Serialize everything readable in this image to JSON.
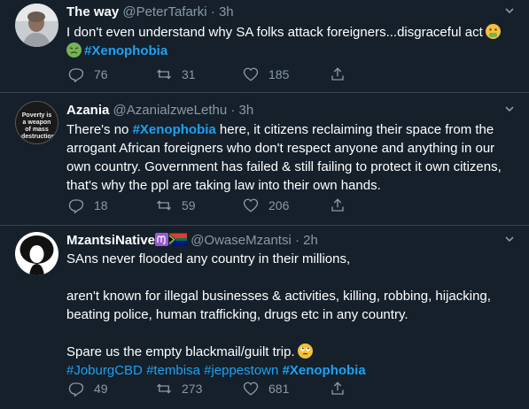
{
  "tweets": [
    {
      "name": "The way",
      "handle": "@PeterTafarki",
      "dot": "·",
      "time": "3h",
      "lines": [
        "I don't even understand why SA folks attack foreigners...disgraceful act"
      ],
      "hashtag_line": "#Xenophobia",
      "stats": {
        "replies": "76",
        "retweets": "31",
        "likes": "185"
      }
    },
    {
      "name": "Azania",
      "handle": "@AzanialzweLethu",
      "dot": "·",
      "time": "3h",
      "avatar_text": "Poverty is a weapon of mass destruction",
      "text_before": "There's no ",
      "hashtag": "#Xenophobia",
      "text_after": " here, it citizens reclaiming their space from the arrogant African foreigners who don't respect anyone and anything in our own country. Government has failed & still failing to protect it own citizens, that's why the ppl are taking law into their own hands.",
      "stats": {
        "replies": "18",
        "retweets": "59",
        "likes": "206"
      }
    },
    {
      "name": "MzantsiNative",
      "handle": "@OwaseMzantsi",
      "dot": "·",
      "time": "2h",
      "para1": "SAns never flooded any country in their millions,",
      "para2": "aren't known for illegal businesses & activities, killing, robbing, hijacking, beating police, human trafficking, drugs etc in any country.",
      "para3": "Spare us the empty blackmail/guilt trip.",
      "hashtags": [
        "#JoburgCBD",
        "#tembisa",
        "#jeppestown"
      ],
      "hashtag_bold": "#Xenophobia",
      "stats": {
        "replies": "49",
        "retweets": "273",
        "likes": "681"
      }
    }
  ],
  "colors": {
    "background": "#15202b",
    "divider": "#38444d",
    "muted": "#8899a6",
    "link": "#1da1f2"
  },
  "icons": [
    "reply-icon",
    "retweet-icon",
    "like-icon",
    "share-icon",
    "caret-down-icon"
  ]
}
